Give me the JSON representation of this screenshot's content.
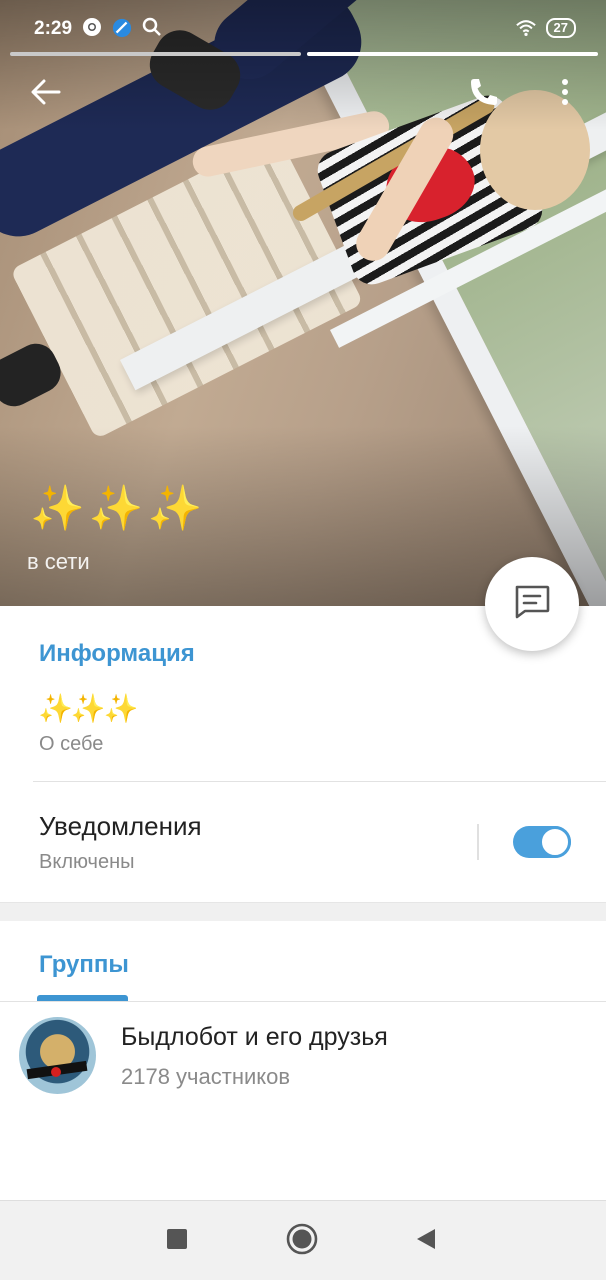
{
  "status_bar": {
    "time": "2:29",
    "battery": "27",
    "icons_left": [
      "chrome-icon",
      "app-icon",
      "search-icon"
    ],
    "icons_right": [
      "wifi-icon",
      "battery-icon"
    ]
  },
  "story_progress": {
    "count": 2,
    "active_index": 1,
    "colors": {
      "inactive": "#c9c9c9",
      "active": "#ffffff"
    }
  },
  "profile": {
    "name": "✨✨✨",
    "status": "в сети"
  },
  "info": {
    "section_title": "Информация",
    "bio_value": "✨✨✨",
    "bio_label": "О себе",
    "notifications_title": "Уведомления",
    "notifications_value": "Включены",
    "notifications_enabled": true
  },
  "groups": {
    "tab_label": "Группы",
    "items": [
      {
        "name": "Быдлобот и его друзья",
        "members": "2178 участников"
      }
    ]
  },
  "colors": {
    "accent": "#3d95d2",
    "toggle": "#4aa0dc",
    "secondary_text": "#8a8a8a"
  }
}
